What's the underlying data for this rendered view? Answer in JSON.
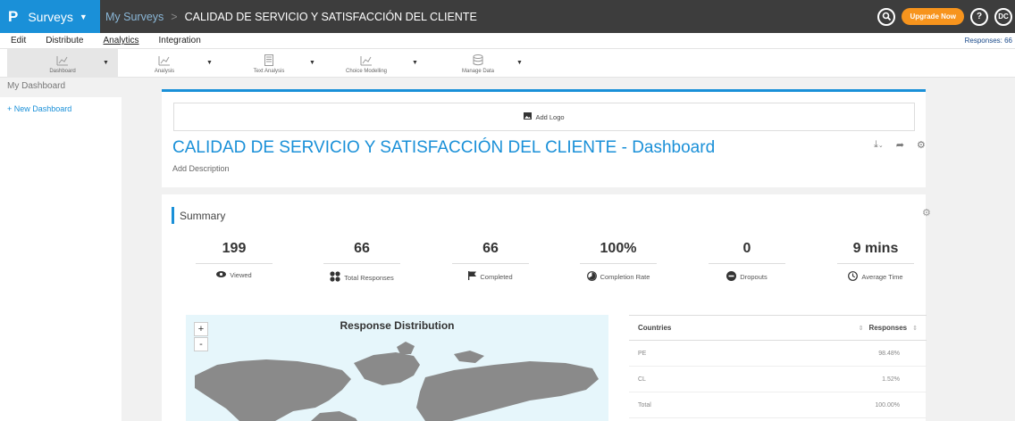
{
  "topbar": {
    "brand_logo": "P",
    "brand_label": "Surveys",
    "breadcrumb_link": "My Surveys",
    "breadcrumb_separator": ">",
    "survey_title": "CALIDAD DE SERVICIO Y SATISFACCIÓN DEL CLIENTE",
    "upgrade_label": "Upgrade Now",
    "help_label": "?",
    "avatar_initials": "DC"
  },
  "menu": {
    "items": [
      "Edit",
      "Distribute",
      "Analytics",
      "Integration"
    ],
    "active": "Analytics",
    "responses_label": "Responses: 66"
  },
  "toolbar": {
    "items": [
      "Dashboard",
      "Analysis",
      "Text Analysis",
      "Choice Modelling",
      "Manage Data"
    ],
    "selected": "Dashboard"
  },
  "sidebar": {
    "title": "My Dashboard",
    "new_dashboard": "+ New Dashboard"
  },
  "dashboard": {
    "add_logo": "Add Logo",
    "title": "CALIDAD DE SERVICIO Y SATISFACCIÓN DEL CLIENTE  - Dashboard",
    "add_description": "Add Description"
  },
  "summary": {
    "title": "Summary",
    "stats": [
      {
        "value": "199",
        "label": "Viewed"
      },
      {
        "value": "66",
        "label": "Total Responses"
      },
      {
        "value": "66",
        "label": "Completed"
      },
      {
        "value": "100%",
        "label": "Completion Rate"
      },
      {
        "value": "0",
        "label": "Dropouts"
      },
      {
        "value": "9 mins",
        "label": "Average Time"
      }
    ]
  },
  "map": {
    "title": "Response Distribution",
    "zoom_in": "+",
    "zoom_out": "-"
  },
  "countries_table": {
    "col1": "Countries",
    "col2": "Responses",
    "rows": [
      {
        "country": "PE",
        "value": "98.48%"
      },
      {
        "country": "CL",
        "value": "1.52%"
      },
      {
        "country": "Total",
        "value": "100.00%"
      }
    ]
  },
  "colors": {
    "brand_blue": "#1a90d8",
    "topbar": "#3d3d3d",
    "upgrade_orange": "#f7941d",
    "map_land": "#8a8a8a",
    "map_water": "#e6f6fb"
  }
}
